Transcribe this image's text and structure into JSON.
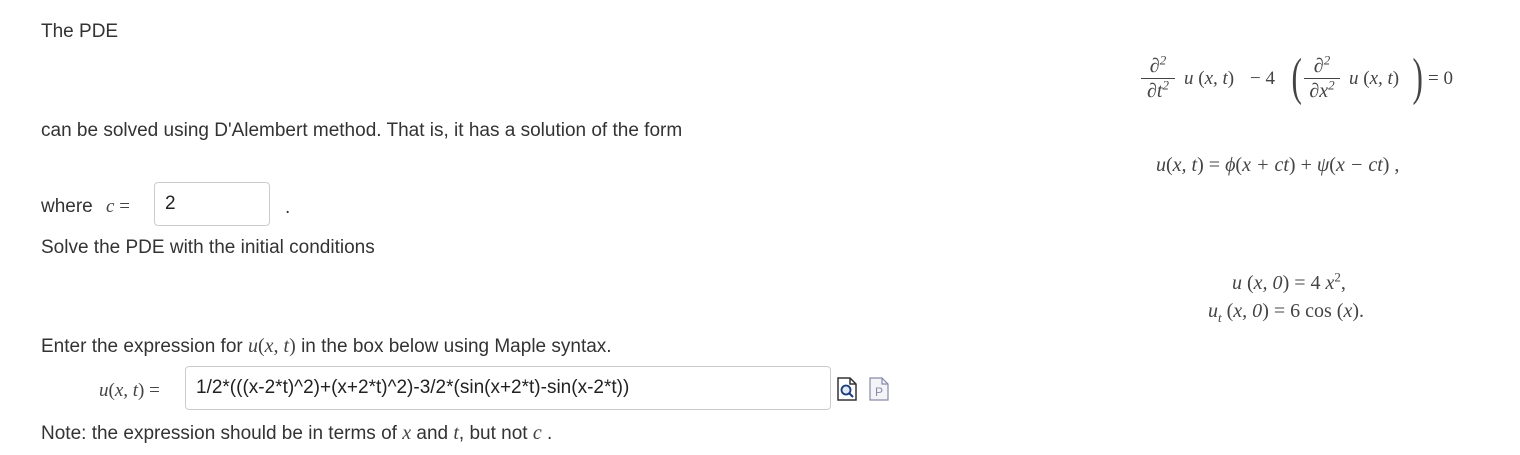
{
  "intro": "The PDE",
  "pde": {
    "d2": "∂2",
    "dt2": "∂t2",
    "dx2": "∂x2",
    "u_xt": "u (x, t)",
    "minus4": "− 4",
    "eq0": "= 0"
  },
  "dalembert_text": "can be solved using D'Alembert method. That is, it has a solution of the form",
  "solution_form": "u(x, t) = ϕ(x + ct) + ψ(x − ct) ,",
  "where": {
    "label": "where",
    "c_label": "c =",
    "c_value": "2",
    "period": "."
  },
  "solve_text": "Solve the PDE with the initial conditions",
  "initial_conditions": {
    "line1": "u (x, 0) = 4 x2,",
    "line2": "ut (x, 0) = 6 cos (x)."
  },
  "enter_text": {
    "before": "Enter the expression for",
    "math": "u(x, t)",
    "after": "in the box below using Maple syntax."
  },
  "answer": {
    "label": "u(x, t) =",
    "value": "1/2*(((x-2*t)^2)+(x+2*t)^2)-3/2*(sin(x+2*t)-sin(x-2*t))"
  },
  "note": {
    "before": "Note: the expression should be in terms of",
    "x": "x",
    "and": "and",
    "t": "t",
    "comma": ", but not",
    "c": "c",
    "end": "."
  },
  "icons": [
    "preview-icon",
    "maple-syntax-icon"
  ]
}
